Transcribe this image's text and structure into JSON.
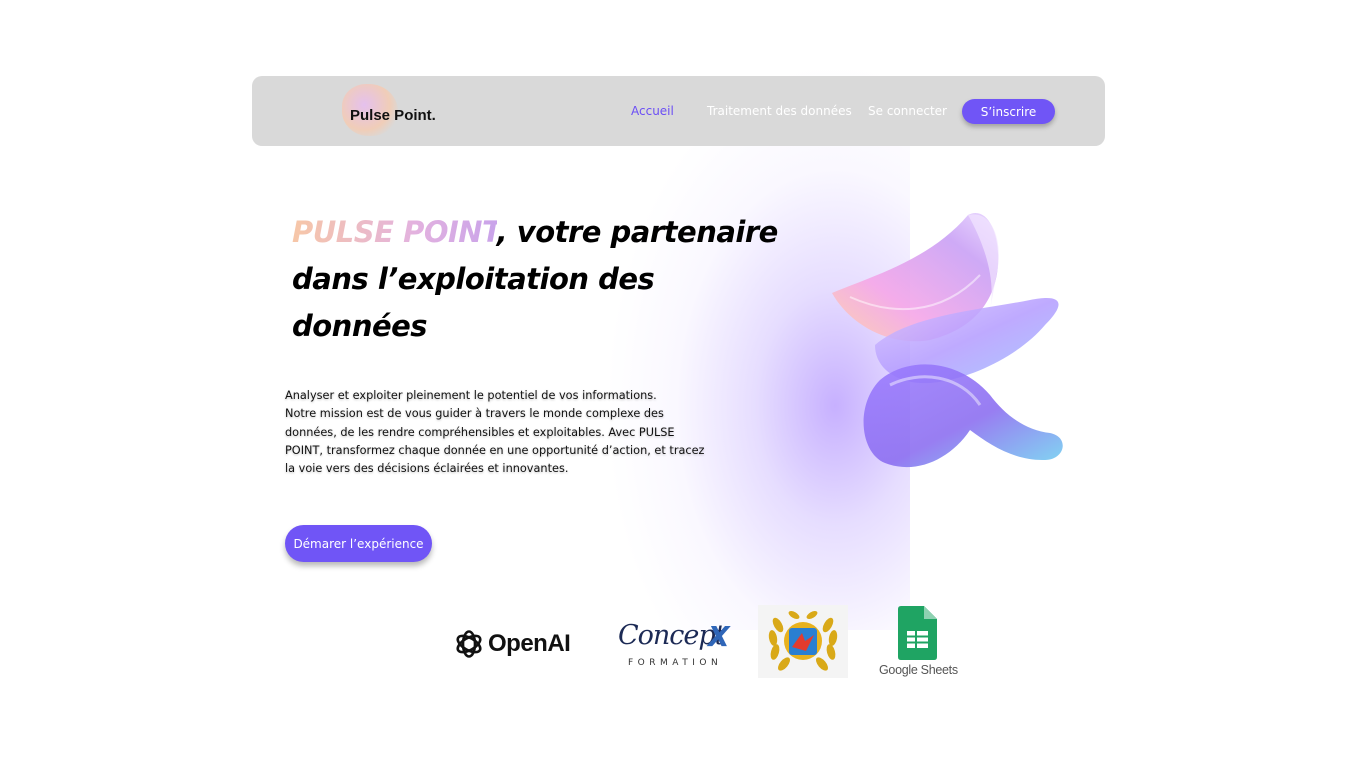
{
  "brand": {
    "name": "Pulse Point."
  },
  "nav": {
    "items": [
      {
        "label": "Accueil",
        "active": true
      },
      {
        "label": "Traitement des données",
        "active": false
      },
      {
        "label": "Se connecter",
        "active": false
      }
    ],
    "signup_label": "S’inscrire"
  },
  "hero": {
    "brand_highlight": "PULSE POINT",
    "title_line1_rest": ", votre partenaire",
    "title_line2": "dans l’exploitation des",
    "title_line3": "données",
    "description_lines": [
      "Analyser et exploiter pleinement le potentiel de vos informations.",
      "Notre mission est de vous guider à travers le monde complexe des",
      "données, de les rendre compréhensibles et exploitables. Avec PULSE",
      "POINT, transformez chaque donnée en une opportunité d’action, et tracez",
      "la voie vers des décisions éclairées et innovantes."
    ],
    "cta_label": "Démarer l’expérience"
  },
  "partners": {
    "openai": "OpenAI",
    "conceptx_script": "Concept",
    "conceptx_x": "X",
    "conceptx_sub": "FORMATION",
    "badge_letter": "B",
    "gsheets": "Google Sheets"
  },
  "colors": {
    "accent": "#7055f6",
    "nav_bg": "#d9d9d9",
    "active_link": "#6b4ef5",
    "brand_gradient_start": "#f7c7a7",
    "brand_gradient_end": "#c9a3ea"
  },
  "icons": {
    "openai": "openai-logo-icon",
    "sheets": "google-sheets-icon",
    "badge": "laurel-badge-icon",
    "logo": "pulse-blob-icon"
  }
}
